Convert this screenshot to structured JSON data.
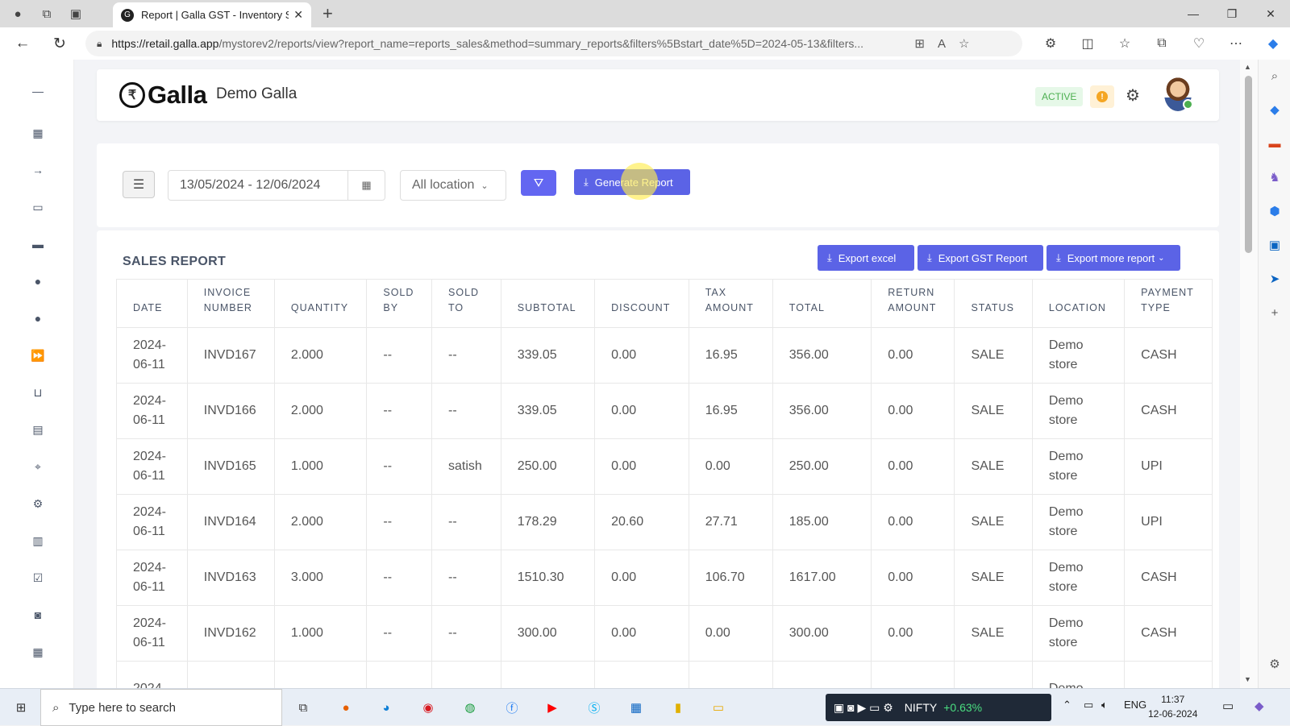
{
  "browser": {
    "tab_title": "Report | Galla GST - Inventory So",
    "tab_favicon": "G",
    "url_host": "https://retail.galla.app",
    "url_path": "/mystorev2/reports/view?report_name=reports_sales&method=summary_reports&filters%5Bstart_date%5D=2024-05-13&filters..."
  },
  "header": {
    "logo_text": "Galla",
    "store_name": "Demo Galla",
    "status_badge": "ACTIVE",
    "notif_glyph": "!"
  },
  "filters": {
    "date_range": "13/05/2024 - 12/06/2024",
    "location": "All location",
    "generate_label": "Generate Report"
  },
  "report": {
    "title": "SALES REPORT",
    "export_excel": "Export excel",
    "export_gst": "Export GST Report",
    "export_more": "Export more report",
    "columns": [
      "DATE",
      "INVOICE NUMBER",
      "QUANTITY",
      "SOLD BY",
      "SOLD TO",
      "SUBTOTAL",
      "DISCOUNT",
      "TAX AMOUNT",
      "TOTAL",
      "RETURN AMOUNT",
      "STATUS",
      "LOCATION",
      "PAYMENT TYPE"
    ],
    "column_lines": [
      [
        "DATE"
      ],
      [
        "INVOICE",
        "NUMBER"
      ],
      [
        "QUANTITY"
      ],
      [
        "SOLD",
        "BY"
      ],
      [
        "SOLD",
        "TO"
      ],
      [
        "SUBTOTAL"
      ],
      [
        "DISCOUNT"
      ],
      [
        "TAX",
        "AMOUNT"
      ],
      [
        "TOTAL"
      ],
      [
        "RETURN",
        "AMOUNT"
      ],
      [
        "STATUS"
      ],
      [
        "LOCATION"
      ],
      [
        "PAYMENT",
        "TYPE"
      ]
    ],
    "rows": [
      [
        "2024-06-11",
        "INVD167",
        "2.000",
        "--",
        "--",
        "339.05",
        "0.00",
        "16.95",
        "356.00",
        "0.00",
        "SALE",
        "Demo store",
        "CASH"
      ],
      [
        "2024-06-11",
        "INVD166",
        "2.000",
        "--",
        "--",
        "339.05",
        "0.00",
        "16.95",
        "356.00",
        "0.00",
        "SALE",
        "Demo store",
        "CASH"
      ],
      [
        "2024-06-11",
        "INVD165",
        "1.000",
        "--",
        "satish",
        "250.00",
        "0.00",
        "0.00",
        "250.00",
        "0.00",
        "SALE",
        "Demo store",
        "UPI"
      ],
      [
        "2024-06-11",
        "INVD164",
        "2.000",
        "--",
        "--",
        "178.29",
        "20.60",
        "27.71",
        "185.00",
        "0.00",
        "SALE",
        "Demo store",
        "UPI"
      ],
      [
        "2024-06-11",
        "INVD163",
        "3.000",
        "--",
        "--",
        "1510.30",
        "0.00",
        "106.70",
        "1617.00",
        "0.00",
        "SALE",
        "Demo store",
        "CASH"
      ],
      [
        "2024-06-11",
        "INVD162",
        "1.000",
        "--",
        "--",
        "300.00",
        "0.00",
        "0.00",
        "300.00",
        "0.00",
        "SALE",
        "Demo store",
        "CASH"
      ],
      [
        "2024-",
        "",
        "",
        "",
        "",
        "",
        "",
        "",
        "",
        "",
        "",
        "Demo",
        ""
      ]
    ]
  },
  "taskbar": {
    "search_placeholder": "Type here to search",
    "ticker": "NIFTY",
    "ticker_change": "+0.63%",
    "lang": "ENG",
    "time": "11:37",
    "date": "12-06-2024"
  },
  "colors": {
    "accent": "#5b63e6",
    "active_badge": "#4caf50",
    "notif": "#f5a623"
  }
}
